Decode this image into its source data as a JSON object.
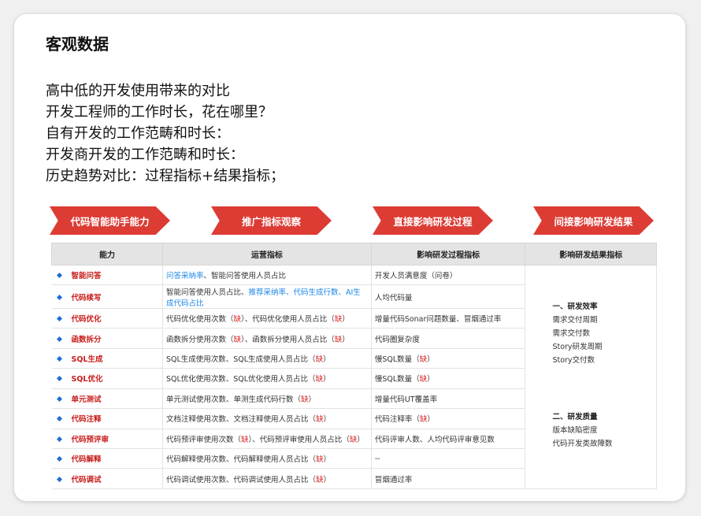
{
  "title": "客观数据",
  "lines": [
    "高中低的开发使用带来的对比",
    "开发工程师的工作时长，花在哪里？",
    "自有开发的工作范畴和时长：",
    "开发商开发的工作范畴和时长：",
    "历史趋势对比：过程指标+结果指标；"
  ],
  "arrows": [
    "代码智能助手能力",
    "推广指标观察",
    "直接影响研发过程",
    "间接影响研发结果"
  ],
  "colors": {
    "arrow": "#dc3c34",
    "capability": "#c8201d",
    "link": "#1a86e8",
    "bullet": "#1e6fd0"
  },
  "table": {
    "headers": [
      "能力",
      "运营指标",
      "影响研发过程指标",
      "影响研发结果指标"
    ],
    "rows": [
      {
        "cap": "智能问答",
        "ops": [
          {
            "t": "问答采纳率",
            "c": "blue"
          },
          {
            "t": "、智能问答使用人员占比"
          }
        ],
        "proc": [
          {
            "t": "开发人员满意度（问卷）"
          }
        ]
      },
      {
        "cap": "代码续写",
        "ops": [
          {
            "t": "智能问答使用人员占比、"
          },
          {
            "t": "推荐采纳率、代码生成行数、AI生成代码占比",
            "c": "blue"
          }
        ],
        "proc": [
          {
            "t": "人均代码量"
          }
        ]
      },
      {
        "cap": "代码优化",
        "ops": [
          {
            "t": "代码优化使用次数（"
          },
          {
            "t": "缺",
            "c": "miss"
          },
          {
            "t": "）、代码优化使用人员占比（"
          },
          {
            "t": "缺",
            "c": "miss"
          },
          {
            "t": "）"
          }
        ],
        "proc": [
          {
            "t": "增量代码Sonar问题数量、冒烟通过率"
          }
        ]
      },
      {
        "cap": "函数拆分",
        "ops": [
          {
            "t": "函数拆分使用次数（"
          },
          {
            "t": "缺",
            "c": "miss"
          },
          {
            "t": "）、函数拆分使用人员占比（"
          },
          {
            "t": "缺",
            "c": "miss"
          },
          {
            "t": "）"
          }
        ],
        "proc": [
          {
            "t": "代码圈复杂度"
          }
        ]
      },
      {
        "cap": "SQL生成",
        "ops": [
          {
            "t": "SQL生成使用次数、SQL生成使用人员占比（"
          },
          {
            "t": "缺",
            "c": "miss"
          },
          {
            "t": "）"
          }
        ],
        "proc": [
          {
            "t": "慢SQL数量（"
          },
          {
            "t": "缺",
            "c": "miss"
          },
          {
            "t": "）"
          }
        ]
      },
      {
        "cap": "SQL优化",
        "ops": [
          {
            "t": "SQL优化使用次数、SQL优化使用人员占比（"
          },
          {
            "t": "缺",
            "c": "miss"
          },
          {
            "t": "）"
          }
        ],
        "proc": [
          {
            "t": "慢SQL数量（"
          },
          {
            "t": "缺",
            "c": "miss"
          },
          {
            "t": "）"
          }
        ]
      },
      {
        "cap": "单元测试",
        "ops": [
          {
            "t": "单元测试使用次数、单测生成代码行数（"
          },
          {
            "t": "缺",
            "c": "miss"
          },
          {
            "t": "）"
          }
        ],
        "proc": [
          {
            "t": "增量代码UT覆盖率"
          }
        ]
      },
      {
        "cap": "代码注释",
        "ops": [
          {
            "t": "文档注释使用次数、文档注释使用人员占比（"
          },
          {
            "t": "缺",
            "c": "miss"
          },
          {
            "t": "）"
          }
        ],
        "proc": [
          {
            "t": "代码注释率（"
          },
          {
            "t": "缺",
            "c": "miss"
          },
          {
            "t": "）"
          }
        ]
      },
      {
        "cap": "代码预评审",
        "ops": [
          {
            "t": "代码预评审使用次数（"
          },
          {
            "t": "缺",
            "c": "miss"
          },
          {
            "t": "）、代码预评审使用人员占比（"
          },
          {
            "t": "缺",
            "c": "miss"
          },
          {
            "t": "）"
          }
        ],
        "proc": [
          {
            "t": "代码评审人数、人均代码评审意见数"
          }
        ]
      },
      {
        "cap": "代码解释",
        "ops": [
          {
            "t": "代码解释使用次数、代码解释使用人员占比（"
          },
          {
            "t": "缺",
            "c": "miss"
          },
          {
            "t": "）"
          }
        ],
        "proc": [
          {
            "t": "--"
          }
        ]
      },
      {
        "cap": "代码调试",
        "ops": [
          {
            "t": "代码调试使用次数、代码调试使用人员占比（"
          },
          {
            "t": "缺",
            "c": "miss"
          },
          {
            "t": "）"
          }
        ],
        "proc": [
          {
            "t": "冒烟通过率"
          }
        ]
      }
    ],
    "results": [
      {
        "heading": "一、研发效率",
        "items": [
          "需求交付周期",
          "需求交付数",
          "Story研发周期",
          "Story交付数"
        ]
      },
      {
        "heading": "二、研发质量",
        "items": [
          "版本缺陷密度",
          "代码开发类故障数"
        ]
      }
    ]
  }
}
